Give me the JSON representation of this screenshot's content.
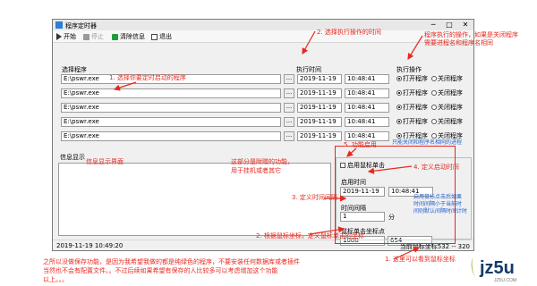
{
  "window": {
    "title": "程序定时器",
    "min_label": "─",
    "max_label": "□",
    "close_label": "✕"
  },
  "toolbar": {
    "start": "开始",
    "stop": "停止",
    "clear_info": "清除信息",
    "exit": "退出"
  },
  "headers": {
    "program": "选择程序",
    "time": "执行时间",
    "action": "执行操作"
  },
  "rows": [
    {
      "path": "E:\\pswr.exe",
      "dots": "...",
      "date": "2019-11-19",
      "time": "10:48:41",
      "open": "打开程序",
      "close": "关闭程序"
    },
    {
      "path": "E:\\pswr.exe",
      "dots": "...",
      "date": "2019-11-19",
      "time": "10:48:41",
      "open": "打开程序",
      "close": "关闭程序"
    },
    {
      "path": "E:\\pswr.exe",
      "dots": "...",
      "date": "2019-11-19",
      "time": "10:48:41",
      "open": "打开程序",
      "close": "关闭程序"
    },
    {
      "path": "E:\\pswr.exe",
      "dots": "...",
      "date": "2019-11-19",
      "time": "10:48:41",
      "open": "打开程序",
      "close": "关闭程序"
    },
    {
      "path": "E:\\pswr.exe",
      "dots": "...",
      "date": "2019-11-19",
      "time": "10:48:41",
      "open": "打开程序",
      "close": "关闭程序"
    }
  ],
  "info": {
    "label": "信息显示"
  },
  "panel": {
    "enable_click": "启用鼠标单击",
    "start_time_label": "启用时间",
    "start_date": "2019-11-19",
    "start_time": "10:48:41",
    "interval_label": "时间间隔",
    "interval_value": "1",
    "interval_unit": "分",
    "click_coord_label": "鼠标单击坐标点",
    "coord_x": "1080",
    "coord_y": "654"
  },
  "status": {
    "datetime": "2019-11-19 10:49:20",
    "mouse": "当前鼠标坐标532 -- 320"
  },
  "annotations": {
    "a1": "1. 选择你要定时启动的程序",
    "a2": "2. 选择执行操作的时间",
    "a3a": "程序执行的操作，如果是关闭程序",
    "a3b": "需要进程名和程序名相同",
    "a_only_close": "只能关闭和程序名相同的进程",
    "a5": "5. 功能启用",
    "a_info": "信息显示界面",
    "a_extra1": "这部分是附赠的功能，",
    "a_extra2": "用于挂机或者其它",
    "a4": "4. 定义启动时间",
    "a3": "3. 定义时间间隔",
    "a_blue1": "启用鼠标点击后如果",
    "a_blue2": "时间间隔小于当前时",
    "a_blue3": "间则默认间隔时间计时",
    "a2b": "2. 根据鼠标坐标，定义鼠标单击的坐标",
    "a1b": "1. 这里可以看到鼠标坐标",
    "bottom1": "之所以没做保存功能，是因为我希望我做的都是纯绿色的程序，不要安装任何数据库或者插件",
    "bottom2": "当然也不会有配置文件。。不过后续如果希望有保存的人比较多可以考虑增加这个功能",
    "bottom3": "以上。。。"
  },
  "logo": {
    "brand": "jz5u",
    "sub": "JZ5U.COM"
  },
  "colors": {
    "annotation_red": "#e8281e",
    "annotation_blue": "#1f5fd0",
    "app_icon": "#2e7dd6"
  }
}
